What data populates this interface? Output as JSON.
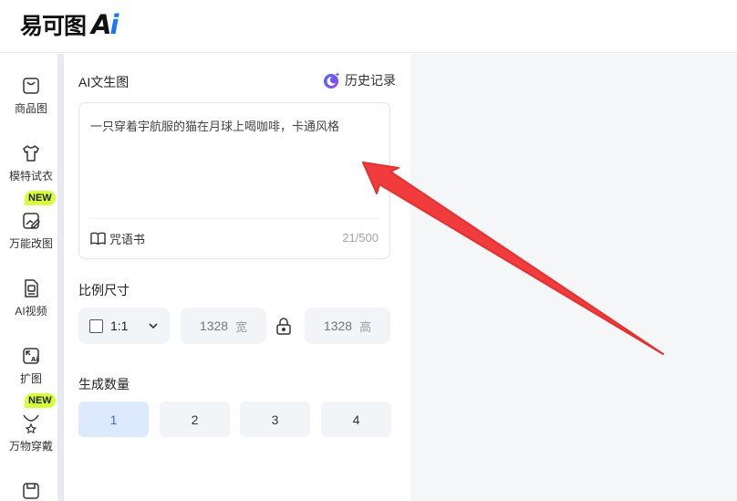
{
  "header": {
    "logo_cn": "易可图",
    "logo_ai_a": "A",
    "logo_ai_i": "i"
  },
  "nav": {
    "badge_new": "NEW",
    "items": [
      {
        "label": "商品图",
        "icon": "shopping-bag-icon"
      },
      {
        "label": "模特试衣",
        "icon": "tshirt-icon"
      },
      {
        "label": "万能改图",
        "icon": "image-edit-icon",
        "badge": "NEW"
      },
      {
        "label": "AI视频",
        "icon": "ai-video-icon"
      },
      {
        "label": "扩图",
        "icon": "expand-image-icon"
      },
      {
        "label": "万物穿戴",
        "icon": "necklace-icon",
        "badge": "NEW"
      },
      {
        "label": "",
        "icon": "product-icon"
      }
    ]
  },
  "panel": {
    "title": "AI文生图",
    "history_label": "历史记录",
    "prompt": {
      "value": "一只穿着宇航服的猫在月球上喝咖啡，卡通风格",
      "spellbook_label": "咒语书",
      "counter": "21/500"
    },
    "ratio": {
      "section_label": "比例尺寸",
      "selected": "1:1",
      "width_value": "1328",
      "width_unit": "宽",
      "height_value": "1328",
      "height_unit": "高"
    },
    "quantity": {
      "section_label": "生成数量",
      "options": [
        "1",
        "2",
        "3",
        "4"
      ],
      "selected": "1"
    }
  },
  "colors": {
    "accent": "#1677ff",
    "badge": "#d6ff3a",
    "selected_bg": "#dce9ff",
    "annotation_arrow": "#f03c3c"
  }
}
